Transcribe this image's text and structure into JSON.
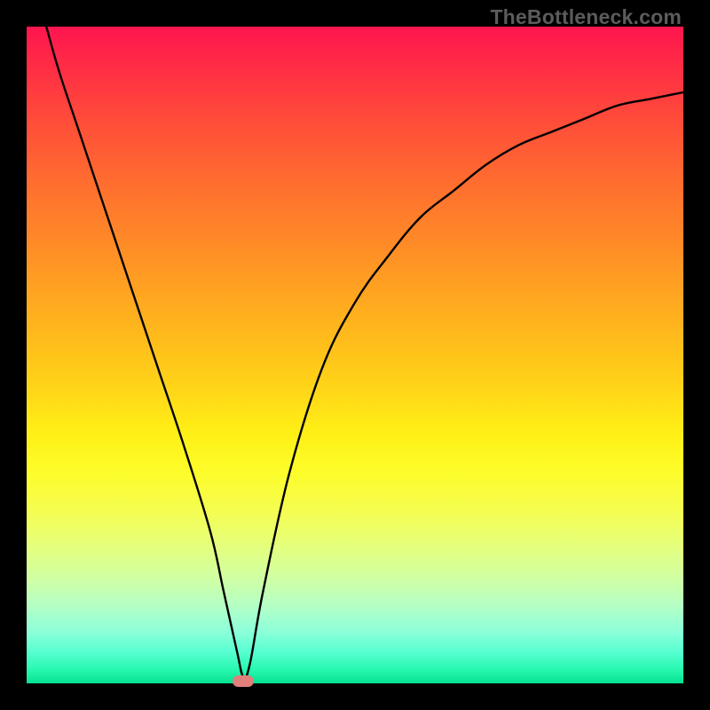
{
  "watermark": "TheBottleneck.com",
  "chart_data": {
    "type": "line",
    "title": "",
    "xlabel": "",
    "ylabel": "",
    "axes_visible": false,
    "grid": false,
    "xlim": [
      0,
      100
    ],
    "ylim": [
      0,
      100
    ],
    "background_gradient": {
      "direction": "vertical",
      "stops": [
        {
          "pos": 0,
          "color": "#ff154f"
        },
        {
          "pos": 50,
          "color": "#ffd118"
        },
        {
          "pos": 70,
          "color": "#fdfd2b"
        },
        {
          "pos": 100,
          "color": "#05e08f"
        }
      ]
    },
    "series": [
      {
        "name": "bottleneck-curve",
        "color": "#000000",
        "x": [
          3,
          5,
          8,
          12,
          16,
          20,
          24,
          28,
          30,
          32,
          33,
          34,
          36,
          40,
          45,
          50,
          55,
          60,
          65,
          70,
          75,
          80,
          85,
          90,
          95,
          100
        ],
        "y": [
          100,
          93,
          84,
          72,
          60,
          48,
          36,
          23,
          14,
          5,
          1,
          3,
          14,
          32,
          48,
          58,
          65,
          71,
          75,
          79,
          82,
          84,
          86,
          88,
          89,
          90
        ]
      }
    ],
    "marker": {
      "x": 33,
      "y": 0,
      "color": "#e17f7b",
      "shape": "pill"
    }
  }
}
